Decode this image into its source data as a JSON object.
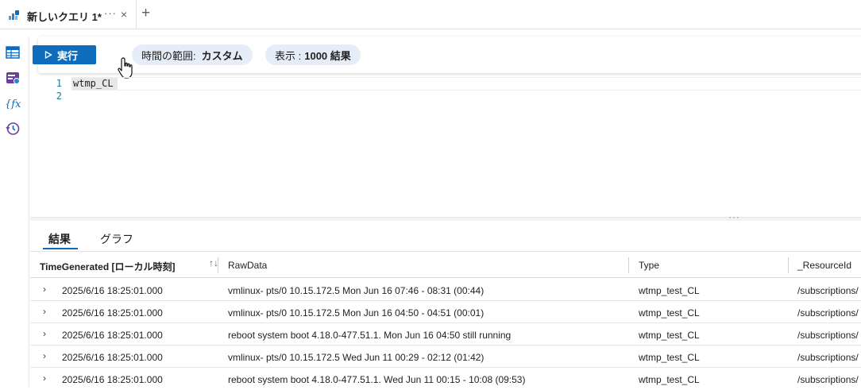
{
  "tab": {
    "title": "新しいクエリ 1*",
    "ellipsis": "···",
    "close": "×",
    "add": "+"
  },
  "rail": {
    "items": [
      "table-icon",
      "saved-query-icon",
      "function-icon",
      "history-icon"
    ]
  },
  "toolbar": {
    "run_label": "実行",
    "time_range_key": "時間の範囲:",
    "time_range_value": "カスタム",
    "display_key": "表示 :",
    "display_value": "1000 結果"
  },
  "editor": {
    "lines": [
      {
        "number": "1",
        "text": "wtmp_CL"
      },
      {
        "number": "2",
        "text": ""
      }
    ]
  },
  "splitter_grip": "···",
  "results": {
    "tabs": [
      "結果",
      "グラフ"
    ],
    "active_tab": "結果",
    "columns": [
      "TimeGenerated [ローカル時刻]",
      "RawData",
      "Type",
      "_ResourceId"
    ],
    "sort_indicator": "↑↓",
    "rows": [
      [
        "2025/6/16 18:25:01.000",
        "vmlinux- pts/0 10.15.172.5 Mon Jun 16 07:46 - 08:31 (00:44)",
        "wtmp_test_CL",
        "/subscriptions/"
      ],
      [
        "2025/6/16 18:25:01.000",
        "vmlinux- pts/0 10.15.172.5 Mon Jun 16 04:50 - 04:51 (00:01)",
        "wtmp_test_CL",
        "/subscriptions/"
      ],
      [
        "2025/6/16 18:25:01.000",
        "reboot system boot 4.18.0-477.51.1. Mon Jun 16 04:50 still running",
        "wtmp_test_CL",
        "/subscriptions/"
      ],
      [
        "2025/6/16 18:25:01.000",
        "vmlinux- pts/0 10.15.172.5 Wed Jun 11 00:29 - 02:12 (01:42)",
        "wtmp_test_CL",
        "/subscriptions/"
      ],
      [
        "2025/6/16 18:25:01.000",
        "reboot system boot 4.18.0-477.51.1. Wed Jun 11 00:15 - 10:08 (09:53)",
        "wtmp_test_CL",
        "/subscriptions/"
      ]
    ]
  },
  "colors": {
    "accent": "#0f6cbd",
    "pill_bg": "#e5eef8",
    "line_number": "#237893"
  }
}
